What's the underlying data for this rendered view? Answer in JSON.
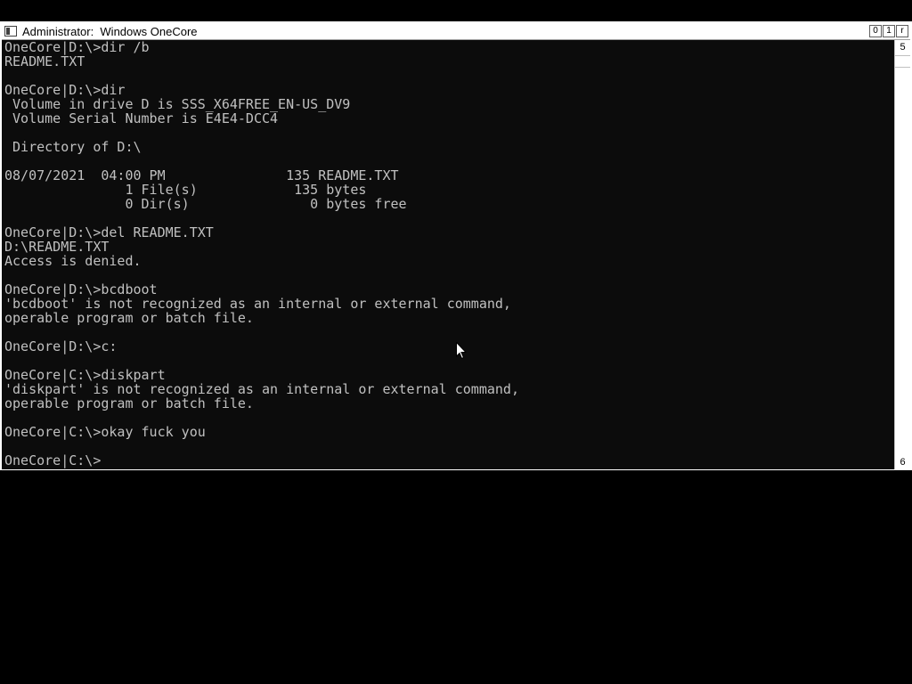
{
  "window": {
    "title": "Administrator:  Windows OneCore",
    "buttons": {
      "minimize": "0",
      "maximize": "1",
      "close": "r"
    }
  },
  "scrollbar": {
    "up_arrow": "5",
    "down_arrow": "6"
  },
  "console": {
    "lines": [
      "OneCore|D:\\>dir /b",
      "README.TXT",
      "",
      "OneCore|D:\\>dir",
      " Volume in drive D is SSS_X64FREE_EN-US_DV9",
      " Volume Serial Number is E4E4-DCC4",
      "",
      " Directory of D:\\",
      "",
      "08/07/2021  04:00 PM               135 README.TXT",
      "               1 File(s)            135 bytes",
      "               0 Dir(s)               0 bytes free",
      "",
      "OneCore|D:\\>del README.TXT",
      "D:\\README.TXT",
      "Access is denied.",
      "",
      "OneCore|D:\\>bcdboot",
      "'bcdboot' is not recognized as an internal or external command,",
      "operable program or batch file.",
      "",
      "OneCore|D:\\>c:",
      "",
      "OneCore|C:\\>diskpart",
      "'diskpart' is not recognized as an internal or external command,",
      "operable program or batch file.",
      "",
      "OneCore|C:\\>okay fuck you",
      "",
      "OneCore|C:\\>"
    ]
  },
  "colors": {
    "console_bg": "#0c0c0c",
    "console_text": "#c0c0c0",
    "desktop_bg": "#000000"
  }
}
